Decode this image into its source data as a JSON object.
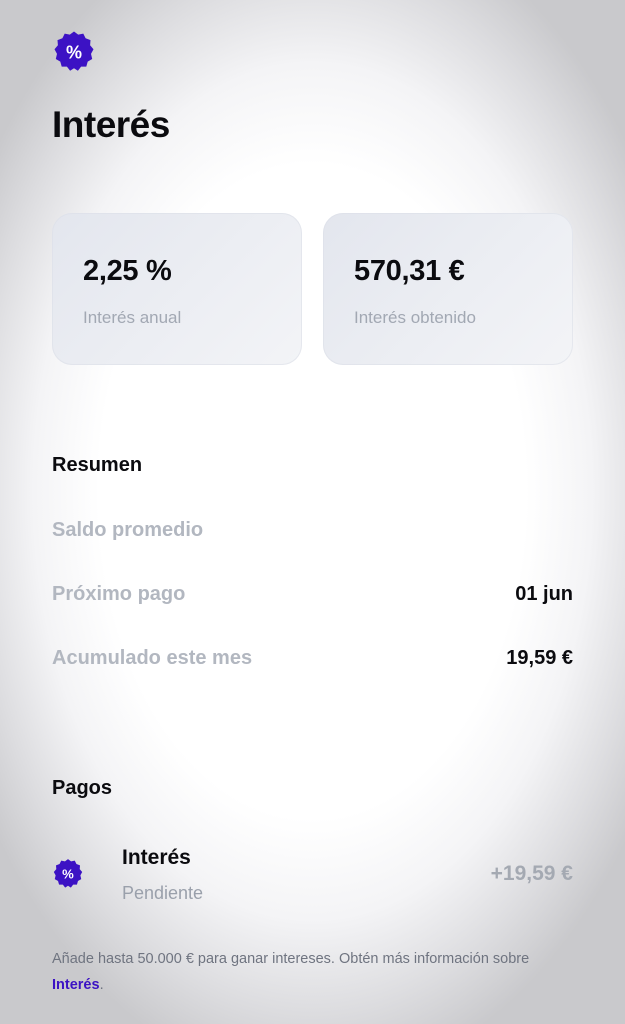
{
  "colors": {
    "accent": "#3C12C4",
    "muted_text": "#B2B7C0",
    "card_bg": "#E8EAF0"
  },
  "header": {
    "icon": "percent-badge-icon",
    "title": "Interés"
  },
  "cards": [
    {
      "value": "2,25 %",
      "label": "Interés anual"
    },
    {
      "value": "570,31 €",
      "label": "Interés obtenido"
    }
  ],
  "summary": {
    "heading": "Resumen",
    "rows": [
      {
        "label": "Saldo promedio",
        "value": ""
      },
      {
        "label": "Próximo pago",
        "value": "01 jun"
      },
      {
        "label": "Acumulado este mes",
        "value": "19,59 €"
      }
    ]
  },
  "payments": {
    "heading": "Pagos",
    "items": [
      {
        "icon": "percent-badge-icon",
        "title": "Interés",
        "status": "Pendiente",
        "amount": "+19,59 €"
      }
    ]
  },
  "footer": {
    "text": "Añade hasta 50.000 € para ganar intereses. Obtén más información sobre ",
    "link": "Interés",
    "suffix": "."
  }
}
